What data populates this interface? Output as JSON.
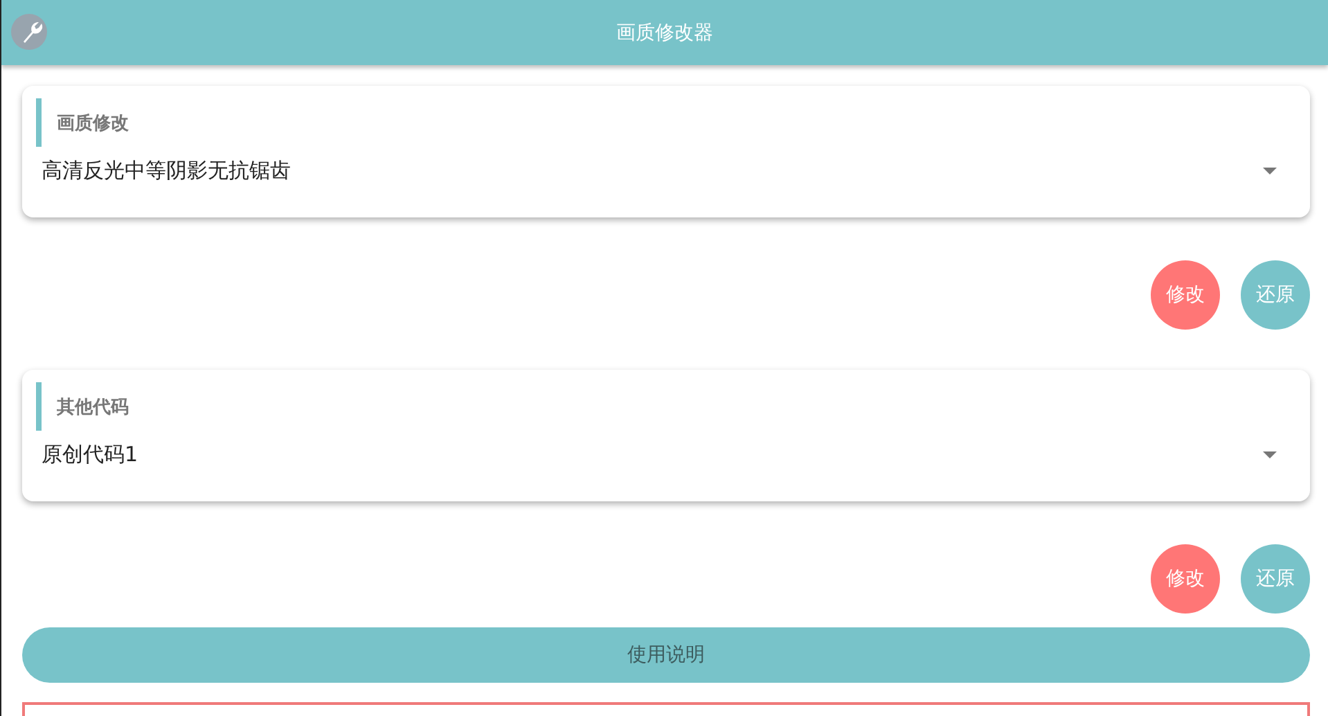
{
  "header": {
    "title": "画质修改器"
  },
  "sections": [
    {
      "label": "画质修改",
      "value": "高清反光中等阴影无抗锯齿",
      "buttons": [
        {
          "label": "修改",
          "kind": "apply"
        },
        {
          "label": "还原",
          "kind": "restore"
        }
      ]
    },
    {
      "label": "其他代码",
      "value": "原创代码1",
      "buttons": [
        {
          "label": "修改",
          "kind": "apply"
        },
        {
          "label": "还原",
          "kind": "restore"
        }
      ]
    }
  ],
  "help_button": "使用说明"
}
